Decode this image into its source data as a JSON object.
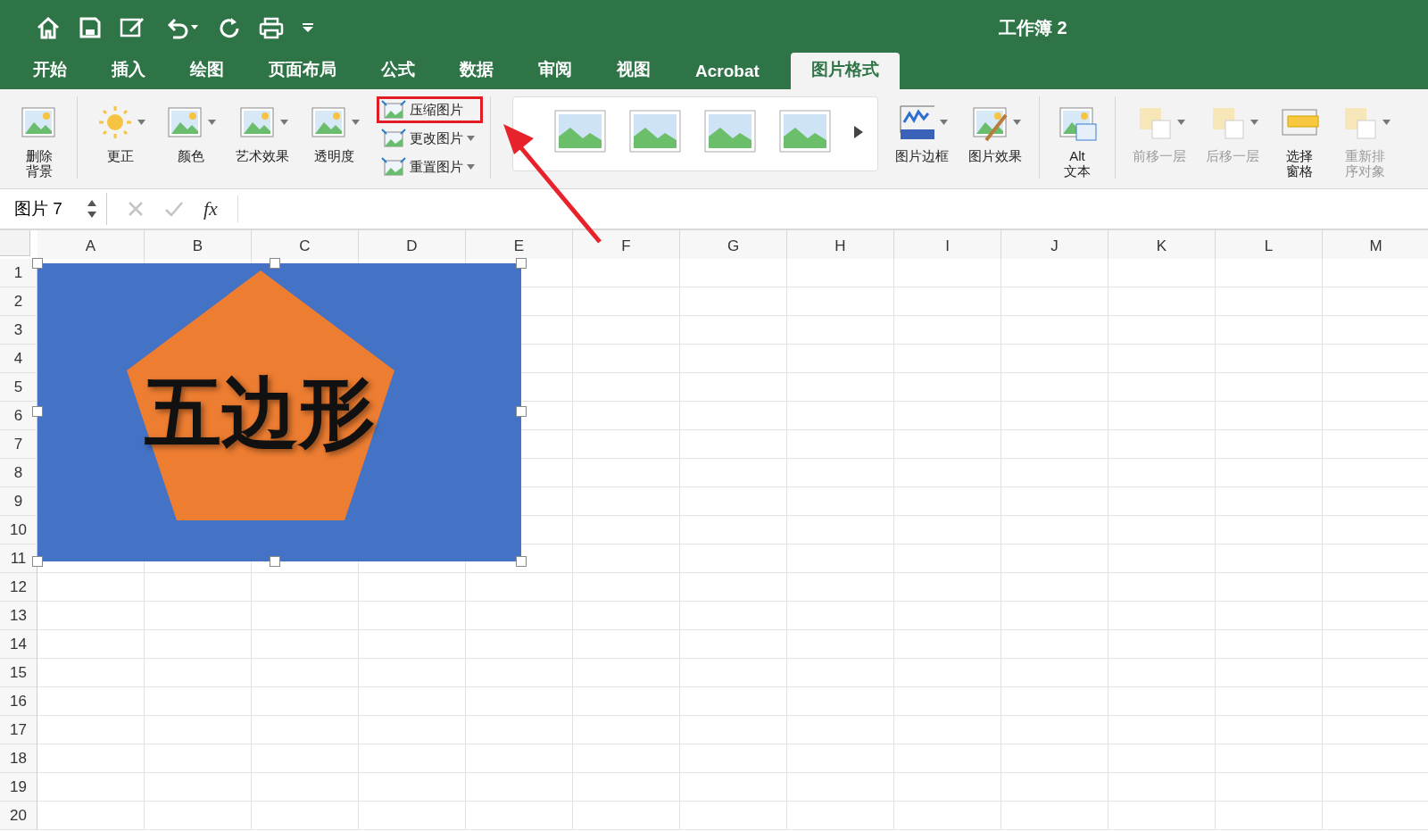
{
  "window": {
    "title": "工作簿 2"
  },
  "tabs": [
    {
      "label": "开始",
      "selected": false
    },
    {
      "label": "插入",
      "selected": false
    },
    {
      "label": "绘图",
      "selected": false
    },
    {
      "label": "页面布局",
      "selected": false
    },
    {
      "label": "公式",
      "selected": false
    },
    {
      "label": "数据",
      "selected": false
    },
    {
      "label": "审阅",
      "selected": false
    },
    {
      "label": "视图",
      "selected": false
    },
    {
      "label": "Acrobat",
      "selected": false
    },
    {
      "label": "图片格式",
      "selected": true
    }
  ],
  "ribbon": [
    {
      "kind": "large",
      "lines": [
        "删除",
        "背景"
      ],
      "dropdown": false,
      "disabled": false
    },
    {
      "kind": "separator"
    },
    {
      "kind": "large",
      "lines": [
        "更正"
      ],
      "dropdown": true,
      "disabled": false
    },
    {
      "kind": "large",
      "lines": [
        "颜色"
      ],
      "dropdown": true,
      "disabled": false
    },
    {
      "kind": "large",
      "lines": [
        "艺术效果"
      ],
      "dropdown": true,
      "disabled": false
    },
    {
      "kind": "large",
      "lines": [
        "透明度"
      ],
      "dropdown": true,
      "disabled": false
    },
    {
      "kind": "stack",
      "items": [
        {
          "label": "压缩图片",
          "dropdown": false,
          "highlighted": true
        },
        {
          "label": "更改图片",
          "dropdown": true,
          "highlighted": false
        },
        {
          "label": "重置图片",
          "dropdown": true,
          "highlighted": false
        }
      ]
    },
    {
      "kind": "separator"
    },
    {
      "kind": "gallery"
    },
    {
      "kind": "large",
      "lines": [
        "图片边框"
      ],
      "dropdown": true,
      "disabled": false
    },
    {
      "kind": "large",
      "lines": [
        "图片效果"
      ],
      "dropdown": true,
      "disabled": false
    },
    {
      "kind": "separator"
    },
    {
      "kind": "large",
      "lines": [
        "Alt",
        "文本"
      ],
      "dropdown": false,
      "disabled": false
    },
    {
      "kind": "separator"
    },
    {
      "kind": "large",
      "lines": [
        "前移一层"
      ],
      "dropdown": true,
      "disabled": true
    },
    {
      "kind": "large",
      "lines": [
        "后移一层"
      ],
      "dropdown": true,
      "disabled": true
    },
    {
      "kind": "large",
      "lines": [
        "选择",
        "窗格"
      ],
      "dropdown": false,
      "disabled": false
    },
    {
      "kind": "large",
      "lines": [
        "重新排",
        "序对象"
      ],
      "dropdown": true,
      "disabled": true
    }
  ],
  "formula_bar": {
    "name_box": "图片 7",
    "fx_label": "fx"
  },
  "columns": [
    "A",
    "B",
    "C",
    "D",
    "E",
    "F",
    "G",
    "H",
    "I",
    "J",
    "K",
    "L",
    "M"
  ],
  "rows": [
    "1",
    "2",
    "3",
    "4",
    "5",
    "6",
    "7",
    "8",
    "9",
    "10",
    "11",
    "12",
    "13",
    "14",
    "15",
    "16",
    "17",
    "18",
    "19",
    "20"
  ],
  "picture": {
    "text": "五边形"
  }
}
